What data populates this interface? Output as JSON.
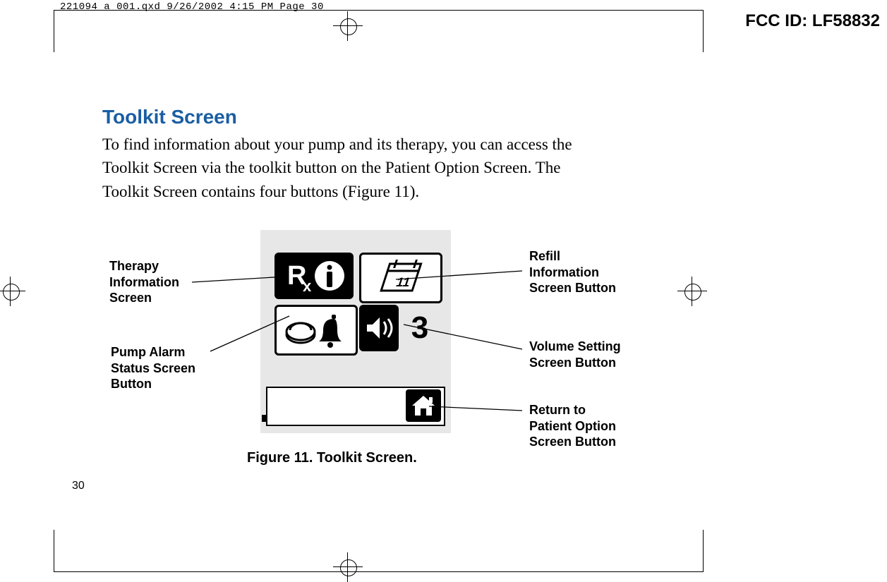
{
  "print_info": "221094_a_001.qxd  9/26/2002  4:15 PM  Page 30",
  "fcc_id": "FCC ID: LF58832",
  "title": "Toolkit Screen",
  "body_text": "To find information about your pump and its therapy, you can access the Toolkit Screen via the toolkit button on the Patient Option Screen. The Toolkit Screen contains four buttons (Figure 11).",
  "labels": {
    "therapy": "Therapy\nInformation\nScreen",
    "pump_alarm": "Pump Alarm\nStatus Screen\nButton",
    "refill": "Refill\nInformation\nScreen Button",
    "volume": "Volume Setting\nScreen Button",
    "return": "Return to\nPatient Option\nScreen Button"
  },
  "figure_caption": "Figure 11. Toolkit Screen.",
  "page_number": "30",
  "device": {
    "calendar_day": "11",
    "volume_level": "3"
  }
}
